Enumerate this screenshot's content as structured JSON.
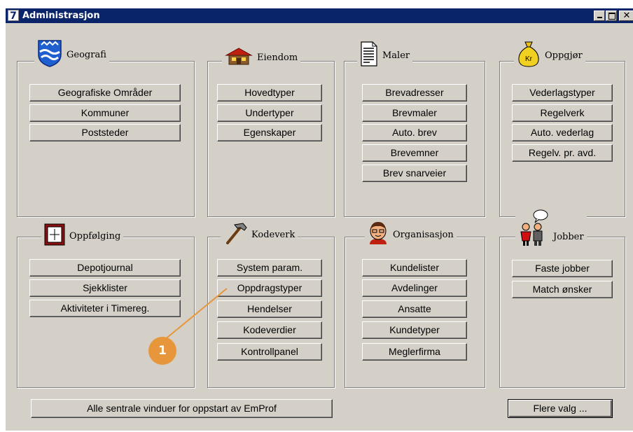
{
  "window": {
    "title": "Administrasjon",
    "app_icon_glyph": "7"
  },
  "groups": {
    "geografi": {
      "label": "Geografi",
      "icon": "coat-of-arms-icon",
      "buttons": [
        "Geografiske Områder",
        "Kommuner",
        "Poststeder"
      ]
    },
    "eiendom": {
      "label": "Eiendom",
      "icon": "house-icon",
      "buttons": [
        "Hovedtyper",
        "Undertyper",
        "Egenskaper"
      ]
    },
    "maler": {
      "label": "Maler",
      "icon": "document-icon",
      "buttons": [
        "Brevadresser",
        "Brevmaler",
        "Auto. brev",
        "Brevemner",
        "Brev snarveier"
      ]
    },
    "oppgjor": {
      "label": "Oppgjør",
      "icon": "money-bag-icon",
      "icon_text": "Kr",
      "buttons": [
        "Vederlagstyper",
        "Regelverk",
        "Auto. vederlag",
        "Regelv. pr. avd."
      ]
    },
    "oppfolging": {
      "label": "Oppfølging",
      "icon": "calendar-icon",
      "buttons": [
        "Depotjournal",
        "Sjekklister",
        "Aktiviteter i Timereg."
      ]
    },
    "kodeverk": {
      "label": "Kodeverk",
      "icon": "hammer-icon",
      "buttons": [
        "System param.",
        "Oppdragstyper",
        "Hendelser",
        "Kodeverdier",
        "Kontrollpanel"
      ]
    },
    "organisasjon": {
      "label": "Organisasjon",
      "icon": "person-face-icon",
      "buttons": [
        "Kundelister",
        "Avdelinger",
        "Ansatte",
        "Kundetyper",
        "Meglerfirma"
      ]
    },
    "jobber": {
      "label": "Jobber",
      "icon": "people-icon",
      "buttons": [
        "Faste jobber",
        "Match ønsker"
      ]
    }
  },
  "bottom": {
    "all_windows": "Alle sentrale vinduer for oppstart av EmProf",
    "more": "Flere valg ..."
  },
  "callout": {
    "number": "1"
  },
  "colors": {
    "titlebar": "#0a246a",
    "face": "#d4d0c8",
    "callout": "#e8963c"
  }
}
